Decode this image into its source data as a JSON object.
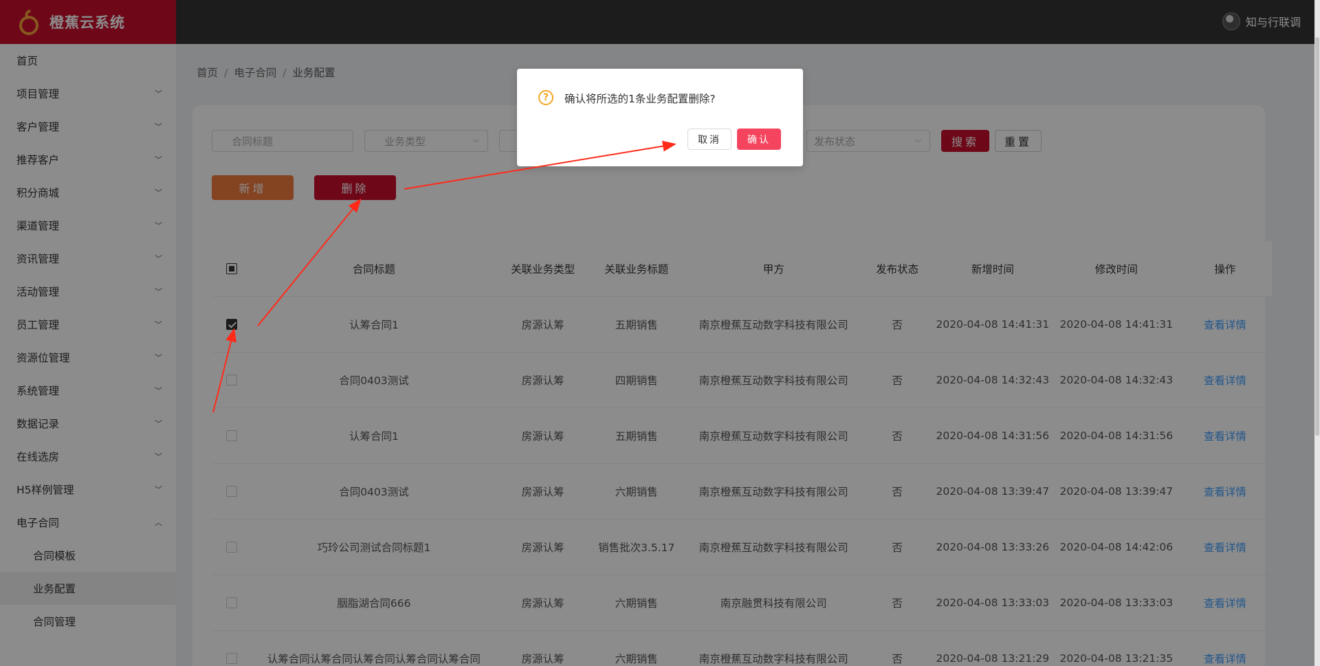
{
  "app": {
    "title": "橙蕉云系统",
    "user_name": "知与行联调"
  },
  "sidebar": {
    "items": [
      {
        "label": "首页",
        "expandable": false
      },
      {
        "label": "项目管理",
        "expandable": true
      },
      {
        "label": "客户管理",
        "expandable": true
      },
      {
        "label": "推荐客户",
        "expandable": true
      },
      {
        "label": "积分商城",
        "expandable": true
      },
      {
        "label": "渠道管理",
        "expandable": true
      },
      {
        "label": "资讯管理",
        "expandable": true
      },
      {
        "label": "活动管理",
        "expandable": true
      },
      {
        "label": "员工管理",
        "expandable": true
      },
      {
        "label": "资源位管理",
        "expandable": true
      },
      {
        "label": "系统管理",
        "expandable": true
      },
      {
        "label": "数据记录",
        "expandable": true
      },
      {
        "label": "在线选房",
        "expandable": true
      },
      {
        "label": "H5样例管理",
        "expandable": true
      },
      {
        "label": "电子合同",
        "expandable": true,
        "expanded": true
      }
    ],
    "sub_items": [
      {
        "label": "合同模板",
        "active": false
      },
      {
        "label": "业务配置",
        "active": true
      },
      {
        "label": "合同管理",
        "active": false
      }
    ]
  },
  "breadcrumb": {
    "home": "首页",
    "section": "电子合同",
    "current": "业务配置"
  },
  "filters": {
    "title_placeholder": "合同标题",
    "type_placeholder": "业务类型",
    "status_placeholder": "发布状态",
    "search_label": "搜索",
    "reset_label": "重置"
  },
  "actions": {
    "add_label": "新增",
    "delete_label": "删除"
  },
  "table": {
    "headers": [
      "合同标题",
      "关联业务类型",
      "关联业务标题",
      "甲方",
      "发布状态",
      "新增时间",
      "修改时间",
      "操作"
    ],
    "rows": [
      {
        "checked": true,
        "title": "认筹合同1",
        "type": "房源认筹",
        "biz": "五期销售",
        "party": "南京橙蕉互动数字科技有限公司",
        "status": "否",
        "created": "2020-04-08 14:41:31",
        "modified": "2020-04-08 14:41:31",
        "op": "查看详情"
      },
      {
        "checked": false,
        "title": "合同0403测试",
        "type": "房源认筹",
        "biz": "四期销售",
        "party": "南京橙蕉互动数字科技有限公司",
        "status": "否",
        "created": "2020-04-08 14:32:43",
        "modified": "2020-04-08 14:32:43",
        "op": "查看详情"
      },
      {
        "checked": false,
        "title": "认筹合同1",
        "type": "房源认筹",
        "biz": "五期销售",
        "party": "南京橙蕉互动数字科技有限公司",
        "status": "否",
        "created": "2020-04-08 14:31:56",
        "modified": "2020-04-08 14:31:56",
        "op": "查看详情"
      },
      {
        "checked": false,
        "title": "合同0403测试",
        "type": "房源认筹",
        "biz": "六期销售",
        "party": "南京橙蕉互动数字科技有限公司",
        "status": "否",
        "created": "2020-04-08 13:39:47",
        "modified": "2020-04-08 13:39:47",
        "op": "查看详情"
      },
      {
        "checked": false,
        "title": "巧玲公司测试合同标题1",
        "type": "房源认筹",
        "biz": "销售批次3.5.17",
        "party": "南京橙蕉互动数字科技有限公司",
        "status": "否",
        "created": "2020-04-08 13:33:26",
        "modified": "2020-04-08 14:42:06",
        "op": "查看详情"
      },
      {
        "checked": false,
        "title": "胭脂湖合同666",
        "type": "房源认筹",
        "biz": "六期销售",
        "party": "南京融贯科技有限公司",
        "status": "否",
        "created": "2020-04-08 13:33:03",
        "modified": "2020-04-08 13:33:03",
        "op": "查看详情"
      },
      {
        "checked": false,
        "title": "认筹合同认筹合同认筹合同认筹合同认筹合同",
        "type": "房源认筹",
        "biz": "六期销售",
        "party": "南京橙蕉互动数字科技有限公司",
        "status": "否",
        "created": "2020-04-08 13:21:29",
        "modified": "2020-04-08 13:21:35",
        "op": "查看详情"
      }
    ]
  },
  "dialog": {
    "message": "确认将所选的1条业务配置删除?",
    "cancel_label": "取消",
    "confirm_label": "确认",
    "icon": "question-icon"
  },
  "colors": {
    "brand": "#c8102e",
    "accent_orange": "#f07a3c",
    "confirm": "#f5445e",
    "link": "#409eff",
    "annotation_arrow": "#ff2a1a"
  }
}
